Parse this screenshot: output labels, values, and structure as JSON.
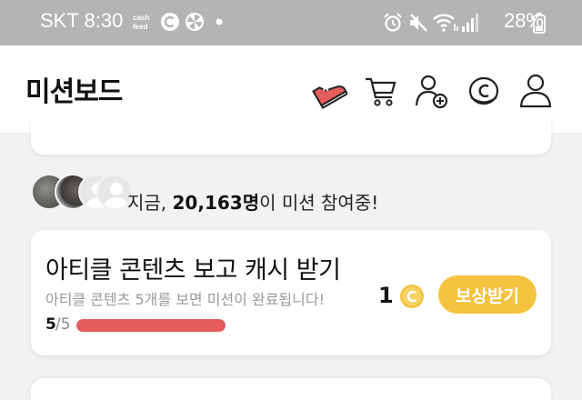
{
  "status_bar": {
    "carrier": "SKT",
    "time": "8:30",
    "battery": "28%",
    "icons": [
      "cashfeed-icon",
      "c-coin-icon",
      "fan-icon",
      "dot-icon",
      "alarm-icon",
      "mute-icon",
      "wifi-icon",
      "signal-icon",
      "battery-icon"
    ]
  },
  "header": {
    "title": "미션보드",
    "icons": [
      "sneaker-icon",
      "cart-icon",
      "add-friend-icon",
      "coin-icon",
      "profile-icon"
    ],
    "accent": "#e55c5c"
  },
  "participants": {
    "prefix": "지금, ",
    "count": "20,163명",
    "suffix": "이 미션 참여중!"
  },
  "mission": {
    "title": "아티클 콘텐츠 보고 캐시 받기",
    "description": "아티클 콘텐츠 5개를 보면 미션이 완료됩니다!",
    "reward_amount": "1",
    "reward_button": "보상받기",
    "progress_done": "5",
    "progress_total": "/5",
    "progress_fraction": 1.0,
    "button_color": "#f4c33f",
    "progress_color": "#e55c5c"
  }
}
